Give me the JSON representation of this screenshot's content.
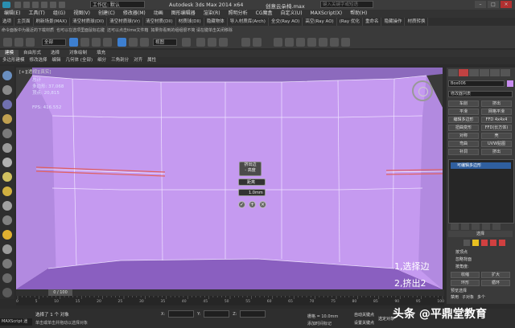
{
  "title_bar": {
    "workspace": "工作区: 默认",
    "app_title": "Autodesk 3ds Max  2014 x64",
    "document": "创意云朵椅.max",
    "search_placeholder": "键入关键字或短语"
  },
  "menu": [
    "编辑(E)",
    "工具(T)",
    "组(G)",
    "视图(V)",
    "创建(C)",
    "修改器(M)",
    "动画",
    "图形编辑器",
    "渲染(R)",
    "照明分析",
    "CG魔盒",
    "自定义(U)",
    "MAXScript(X)",
    "帮助(H)"
  ],
  "plugin_bar": [
    "选项",
    "主页面",
    "刷新场景(MAX)",
    "清空材质球(Dll)",
    "清空材质球(Vr)",
    "清空材质(Dll)",
    "材质球(Dll)",
    "隐藏物体",
    "导入材质库(Arch)",
    "全交(Ray AO)",
    "高空(Ray AO)",
    "(Ray 优化",
    "重命名",
    "隐藏操作",
    "材质转换",
    "整理遗失贴图",
    "转移功能",
    "超改效果(Ray)"
  ],
  "plugin_bar_2": [
    "命令面板中为最近的下载材质",
    "也可以在选项里面鼠标右键",
    "还可以点击time文件箱",
    "如果你看到的组组很不简 请在键单击关闭移除"
  ],
  "toolbar": {
    "selection_filter": "全部",
    "view_space": "视图"
  },
  "ribbon_tabs": [
    "建模",
    "自由形式",
    "选择",
    "对象绘制",
    "填充"
  ],
  "ribbon_tabs_active": "建模",
  "ribbon_sub": [
    "多边形建模",
    "修改选择",
    "编辑",
    "几何体 (全部)",
    "细分",
    "三角剖分",
    "对齐",
    "属性"
  ],
  "viewport": {
    "label": "[+][透视][真实]",
    "stats_total_label": "总计",
    "stats_polys": "多边形: 37,068",
    "stats_verts": "顶点:    20,815",
    "fps": "FPS:    416.552",
    "caddy_title": "挤出边",
    "caddy_sub": "- 高度",
    "caddy_height": "距离",
    "caddy_width": "1.0mm",
    "ok": "✓",
    "apply": "+",
    "cancel": "×",
    "annotation_1": "1,选择边",
    "annotation_2": "2,挤出2"
  },
  "command_panel": {
    "object_name": "Box006",
    "modifier_list": "修改器列表",
    "modifier_buttons": [
      "车削",
      "挤出",
      "平滑",
      "网格平滑",
      "编辑多边形",
      "FFD 4x4x4",
      "扭曲变形",
      "FFD(长方体)",
      "对称",
      "壳",
      "弯曲",
      "UVW贴图",
      "补洞",
      "挤出"
    ],
    "stack_item": "可编辑多边形",
    "selection_rollout": "选择",
    "by_vertex": "按顶点",
    "ignore_backfacing": "忽略背面",
    "by_angle": "按角度:",
    "shrink": "收缩",
    "grow": "扩大",
    "ring": "环形",
    "loop": "循环",
    "preview_selection": "预览选择",
    "disabled": "禁用",
    "subobject": "子对象",
    "multiple": "多个"
  },
  "timeline": {
    "frame": "0 / 100",
    "ticks": [
      "0",
      "5",
      "10",
      "15",
      "20",
      "25",
      "30",
      "35",
      "40",
      "45",
      "50",
      "55",
      "60",
      "65",
      "70",
      "75",
      "80",
      "85",
      "90",
      "95",
      "100"
    ]
  },
  "status": {
    "maxscript": "MAXScript 迷",
    "selected": "选择了 1 个 对象",
    "hint": "单击或单击并拖动以选择对象",
    "x_label": "X:",
    "y_label": "Y:",
    "z_label": "Z:",
    "grid": "栅格 = 10.0mm",
    "add_time_tag": "添加时间标记",
    "auto_key": "自动关键点",
    "set_key": "设置关键点",
    "selected_obj": "选定对象"
  },
  "watermark": "头条 @平鼎堂教育",
  "colors": {
    "mesh": "#c59af0",
    "selected_edge": "#e06060",
    "active_tab": "#c14242"
  }
}
